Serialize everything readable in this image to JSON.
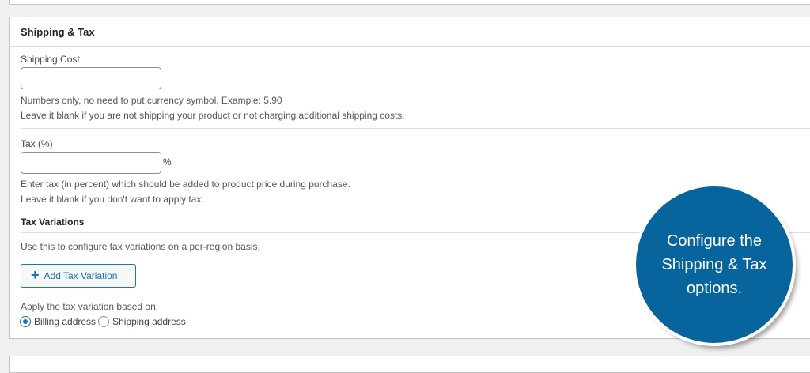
{
  "panel": {
    "title": "Shipping & Tax"
  },
  "shipping": {
    "label": "Shipping Cost",
    "value": "",
    "help_1": "Numbers only, no need to put currency symbol. Example: 5.90",
    "help_2": "Leave it blank if you are not shipping your product or not charging additional shipping costs."
  },
  "tax": {
    "label": "Tax (%)",
    "value": "",
    "suffix": "%",
    "help_1": "Enter tax (in percent) which should be added to product price during purchase.",
    "help_2": "Leave it blank if you don't want to apply tax."
  },
  "tax_variations": {
    "title": "Tax Variations",
    "description": "Use this to configure tax variations on a per-region basis.",
    "add_button": "Add Tax Variation",
    "apply_label": "Apply the tax variation based on:",
    "options": [
      {
        "label": "Billing address",
        "checked": true
      },
      {
        "label": "Shipping address",
        "checked": false
      }
    ]
  },
  "callout": {
    "text": "Configure the Shipping & Tax options.",
    "color": "#07649c"
  }
}
